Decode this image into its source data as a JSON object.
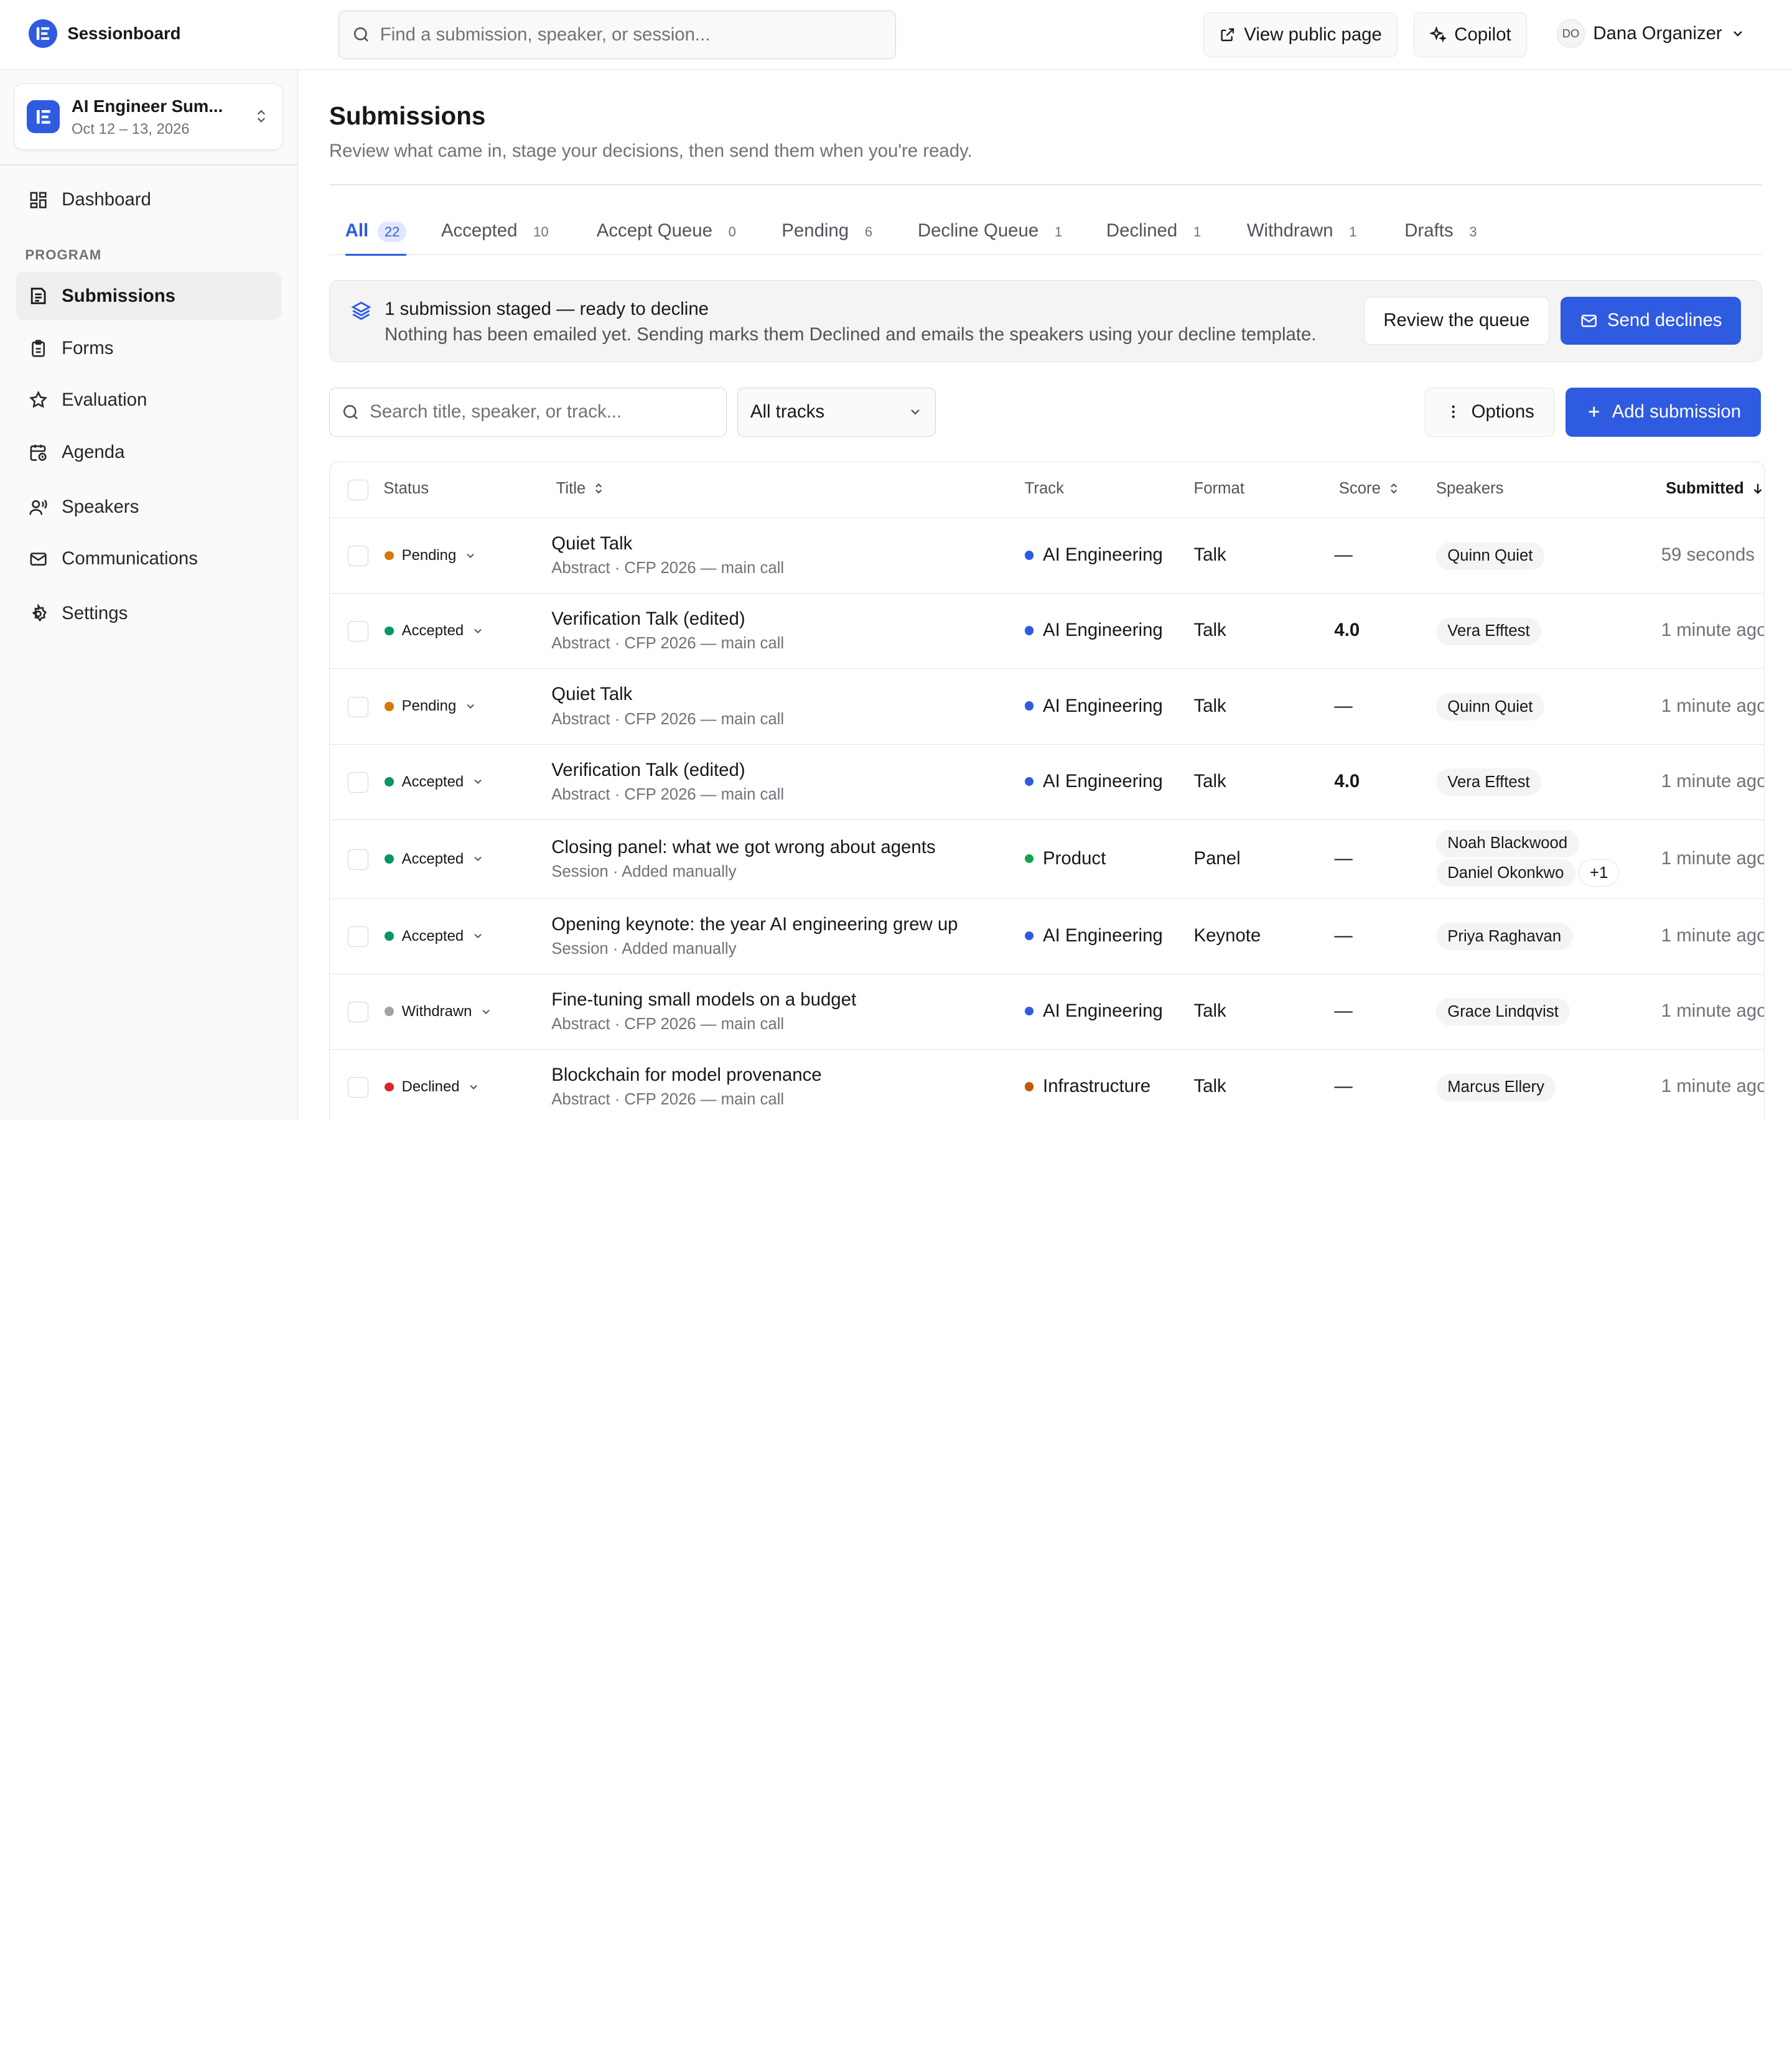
{
  "app": {
    "name": "Sessionboard"
  },
  "search": {
    "placeholder": "Find a submission, speaker, or session..."
  },
  "topbar": {
    "view_public": "View public page",
    "copilot": "Copilot",
    "user_initials": "DO",
    "user_name": "Dana Organizer"
  },
  "event": {
    "name": "AI Engineer Sum...",
    "dates": "Oct 12 – 13, 2026"
  },
  "sidebar": {
    "section_label": "PROGRAM",
    "items": [
      {
        "label": "Dashboard",
        "icon": "dashboard-icon"
      },
      {
        "label": "Submissions",
        "icon": "submissions-icon",
        "active": true
      },
      {
        "label": "Forms",
        "icon": "clipboard-icon"
      },
      {
        "label": "Evaluation",
        "icon": "star-icon"
      },
      {
        "label": "Agenda",
        "icon": "calendar-clock-icon"
      },
      {
        "label": "Speakers",
        "icon": "speaker-icon"
      },
      {
        "label": "Communications",
        "icon": "mail-icon"
      },
      {
        "label": "Settings",
        "icon": "gear-icon"
      }
    ]
  },
  "page": {
    "title": "Submissions",
    "subtitle": "Review what came in, stage your decisions, then send them when you're ready."
  },
  "tabs": [
    {
      "label": "All",
      "count": "22",
      "active": true
    },
    {
      "label": "Accepted",
      "count": "10"
    },
    {
      "label": "Accept Queue",
      "count": "0"
    },
    {
      "label": "Pending",
      "count": "6"
    },
    {
      "label": "Decline Queue",
      "count": "1"
    },
    {
      "label": "Declined",
      "count": "1"
    },
    {
      "label": "Withdrawn",
      "count": "1"
    },
    {
      "label": "Drafts",
      "count": "3"
    }
  ],
  "banner": {
    "title": "1 submission staged — ready to decline",
    "subtitle": "Nothing has been emailed yet. Sending marks them Declined and emails the speakers using your decline template.",
    "review_label": "Review the queue",
    "send_label": "Send declines"
  },
  "filters": {
    "search_placeholder": "Search title, speaker, or track...",
    "track_value": "All tracks",
    "options_label": "Options",
    "add_label": "Add submission"
  },
  "table": {
    "columns": {
      "status": "Status",
      "title": "Title",
      "track": "Track",
      "format": "Format",
      "score": "Score",
      "speakers": "Speakers",
      "submitted": "Submitted"
    },
    "status_colors": {
      "Pending": "#d97706",
      "Accepted": "#059669",
      "Withdrawn": "#a1a1aa",
      "Declined": "#dc2626"
    },
    "track_colors": {
      "AI Engineering": "#2f5be0",
      "Product": "#16a34a",
      "Infrastructure": "#c2570c"
    },
    "rows": [
      {
        "status": "Pending",
        "title": "Quiet Talk",
        "sub": "Abstract · CFP 2026 — main call",
        "track": "AI Engineering",
        "format": "Talk",
        "score": "—",
        "speakers": [
          "Quinn Quiet"
        ],
        "submitted": "59 seconds"
      },
      {
        "status": "Accepted",
        "title": "Verification Talk (edited)",
        "sub": "Abstract · CFP 2026 — main call",
        "track": "AI Engineering",
        "format": "Talk",
        "score": "4.0",
        "speakers": [
          "Vera Efftest"
        ],
        "submitted": "1 minute ago"
      },
      {
        "status": "Pending",
        "title": "Quiet Talk",
        "sub": "Abstract · CFP 2026 — main call",
        "track": "AI Engineering",
        "format": "Talk",
        "score": "—",
        "speakers": [
          "Quinn Quiet"
        ],
        "submitted": "1 minute ago"
      },
      {
        "status": "Accepted",
        "title": "Verification Talk (edited)",
        "sub": "Abstract · CFP 2026 — main call",
        "track": "AI Engineering",
        "format": "Talk",
        "score": "4.0",
        "speakers": [
          "Vera Efftest"
        ],
        "submitted": "1 minute ago"
      },
      {
        "status": "Accepted",
        "title": "Closing panel: what we got wrong about agents",
        "sub": "Session · Added manually",
        "track": "Product",
        "format": "Panel",
        "score": "—",
        "speakers": [
          "Noah Blackwood",
          "Daniel Okonkwo"
        ],
        "more": "+1",
        "submitted": "1 minute ago"
      },
      {
        "status": "Accepted",
        "title": "Opening keynote: the year AI engineering grew up",
        "sub": "Session · Added manually",
        "track": "AI Engineering",
        "format": "Keynote",
        "score": "—",
        "speakers": [
          "Priya Raghavan"
        ],
        "submitted": "1 minute ago"
      },
      {
        "status": "Withdrawn",
        "title": "Fine-tuning small models on a budget",
        "sub": "Abstract · CFP 2026 — main call",
        "track": "AI Engineering",
        "format": "Talk",
        "score": "—",
        "speakers": [
          "Grace Lindqvist"
        ],
        "submitted": "1 minute ago"
      },
      {
        "status": "Declined",
        "title": "Blockchain for model provenance",
        "sub": "Abstract · CFP 2026 — main call",
        "track": "Infrastructure",
        "format": "Talk",
        "score": "—",
        "speakers": [
          "Marcus Ellery"
        ],
        "submitted": "1 minute ago"
      }
    ]
  }
}
